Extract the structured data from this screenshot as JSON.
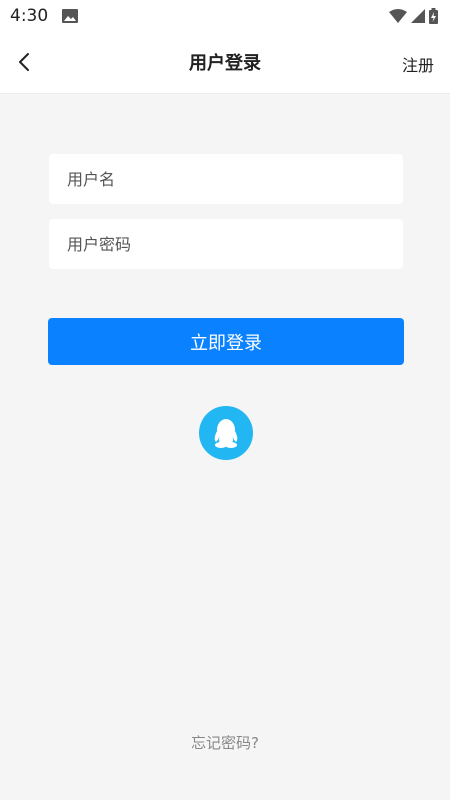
{
  "status_bar": {
    "time": "4:30"
  },
  "header": {
    "title": "用户登录",
    "register_label": "注册"
  },
  "form": {
    "username_placeholder": "用户名",
    "password_placeholder": "用户密码",
    "login_label": "立即登录"
  },
  "footer": {
    "forgot_label": "忘记密码?"
  },
  "colors": {
    "primary": "#0a82ff",
    "qq": "#22b7f2",
    "background": "#f5f5f5"
  },
  "icons": [
    "back-arrow-icon",
    "qq-penguin-icon",
    "image-icon",
    "wifi-icon",
    "signal-icon",
    "battery-icon"
  ]
}
